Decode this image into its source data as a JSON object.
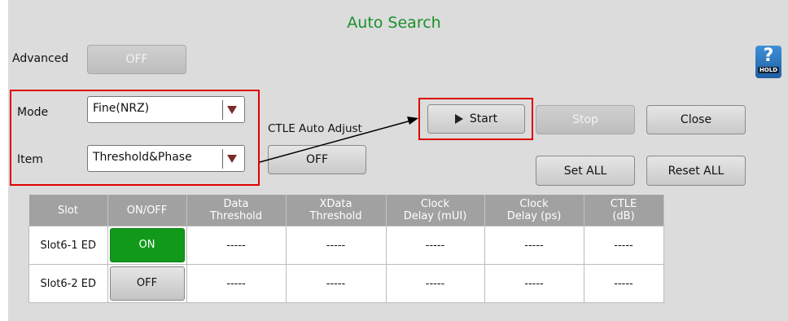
{
  "title": "Auto Search",
  "advanced": {
    "label": "Advanced",
    "value": "OFF"
  },
  "mode": {
    "label": "Mode",
    "value": "Fine(NRZ)"
  },
  "item": {
    "label": "Item",
    "value": "Threshold&Phase"
  },
  "ctle": {
    "label": "CTLE Auto Adjust",
    "value": "OFF"
  },
  "buttons": {
    "start": "Start",
    "stop": "Stop",
    "close": "Close",
    "set_all": "Set ALL",
    "reset_all": "Reset ALL"
  },
  "help": {
    "icon": "question-icon",
    "hold": "HOLD"
  },
  "table": {
    "headers": [
      [
        "Slot",
        ""
      ],
      [
        "ON/OFF",
        ""
      ],
      [
        "Data",
        "Threshold"
      ],
      [
        "XData",
        "Threshold"
      ],
      [
        "Clock",
        "Delay (mUI)"
      ],
      [
        "Clock",
        "Delay (ps)"
      ],
      [
        "CTLE",
        "(dB)"
      ]
    ],
    "rows": [
      {
        "slot": "Slot6-1 ED",
        "state": "ON",
        "values": [
          "-----",
          "-----",
          "-----",
          "-----",
          "-----"
        ]
      },
      {
        "slot": "Slot6-2 ED",
        "state": "OFF",
        "values": [
          "-----",
          "-----",
          "-----",
          "-----",
          "-----"
        ]
      }
    ]
  },
  "colors": {
    "accent": "#19912b",
    "highlight": "#e00000",
    "on": "#119a1a"
  }
}
